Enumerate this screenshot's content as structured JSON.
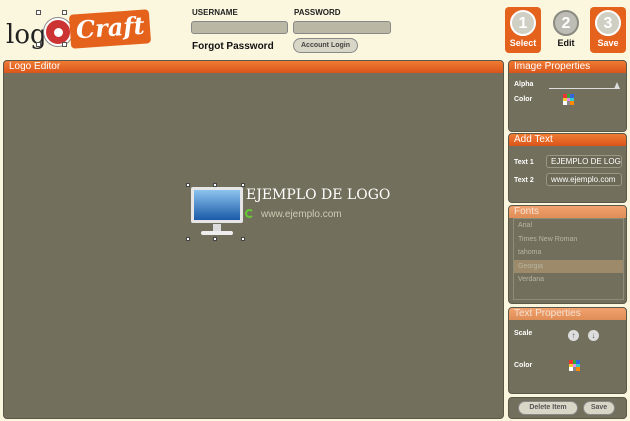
{
  "brand": {
    "logo_left": "logo",
    "logo_right": "Craft"
  },
  "login": {
    "username_label": "USERNAME",
    "password_label": "PASSWORD",
    "username_value": "",
    "password_value": "",
    "forgot_label": "Forgot Password",
    "login_button": "Account Login"
  },
  "steps": [
    {
      "number": "1",
      "label": "Select",
      "active": true
    },
    {
      "number": "2",
      "label": "Edit",
      "active": false
    },
    {
      "number": "3",
      "label": "Save",
      "active": true
    }
  ],
  "editor": {
    "title": "Logo Editor",
    "logo_text": "EJEMPLO DE LOGO",
    "logo_subtext": "www.ejemplo.com"
  },
  "image_properties": {
    "title": "Image Properties",
    "alpha_label": "Alpha",
    "alpha_value": 1.0,
    "color_label": "Color"
  },
  "add_text": {
    "title": "Add Text",
    "text1_label": "Text 1",
    "text1_value": "EJEMPLO DE LOGO",
    "text2_label": "Text 2",
    "text2_value": "www.ejemplo.com"
  },
  "fonts": {
    "title": "Fonts",
    "items": [
      "Arial",
      "Times New Roman",
      "tahoma",
      "Georgia",
      "Verdana"
    ],
    "selected": "Georgia"
  },
  "text_properties": {
    "title": "Text Properties",
    "scale_label": "Scale",
    "color_label": "Color",
    "scale_up_icon": "↑",
    "scale_down_icon": "↓"
  },
  "actions": {
    "delete_label": "Delete Item",
    "save_label": "Save"
  },
  "colors": {
    "accent": "#e5621c",
    "panel": "#726f5c",
    "background": "#fbf7df"
  }
}
